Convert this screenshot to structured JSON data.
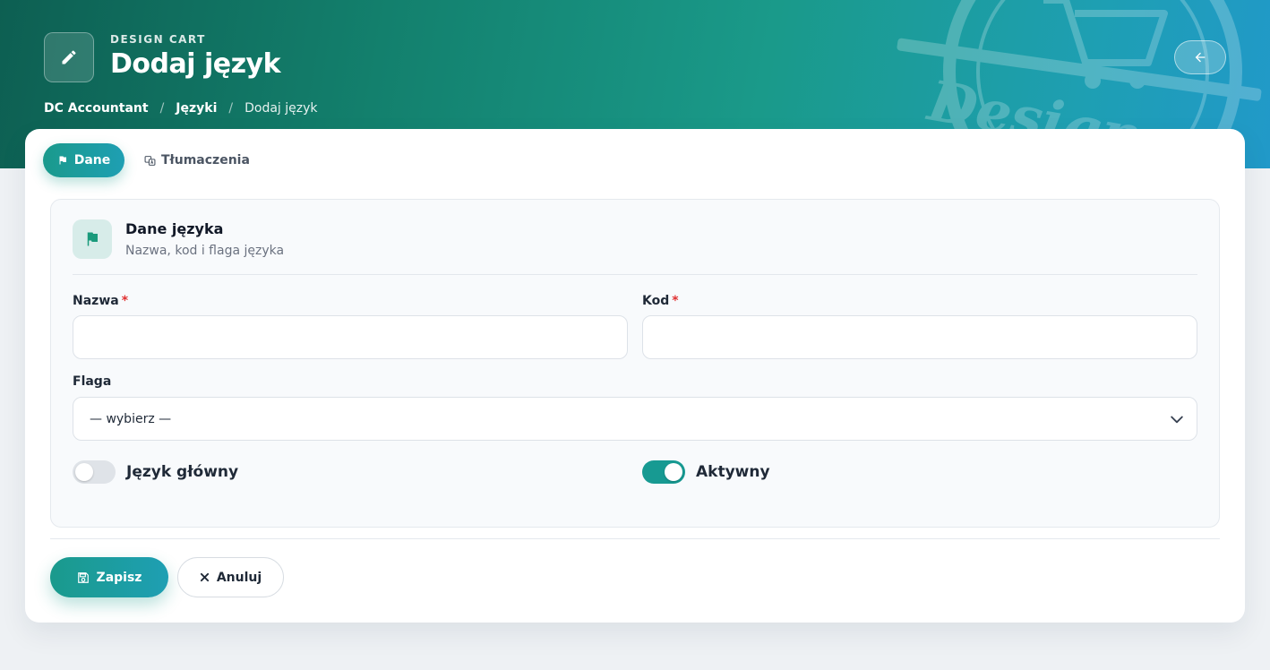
{
  "colors": {
    "accent": "#1a9a8c",
    "accent_alt": "#1e9fb3",
    "required": "#e03131",
    "hero_dark": "#0d5f52"
  },
  "header": {
    "icon": "pencil-icon",
    "kicker": "DESIGN CART",
    "title": "Dodaj język",
    "watermark_text": "Design",
    "back_icon": "arrow-left-icon"
  },
  "breadcrumb": {
    "items": [
      {
        "label": "DC Accountant"
      },
      {
        "label": "Języki"
      },
      {
        "label": "Dodaj język"
      }
    ],
    "separator": "/"
  },
  "tabs": [
    {
      "label": "Dane",
      "icon": "flag-icon",
      "active": true
    },
    {
      "label": "Tłumaczenia",
      "icon": "language-icon",
      "active": false
    }
  ],
  "panel": {
    "icon": "flag-icon",
    "title": "Dane języka",
    "subtitle": "Nazwa, kod i flaga języka"
  },
  "form": {
    "name": {
      "label": "Nazwa",
      "required_mark": "*",
      "value": "",
      "placeholder": ""
    },
    "code": {
      "label": "Kod",
      "required_mark": "*",
      "value": "",
      "placeholder": ""
    },
    "flag": {
      "label": "Flaga",
      "selected": "— wybierz —"
    },
    "main_language": {
      "label": "Język główny",
      "on": false
    },
    "active": {
      "label": "Aktywny",
      "on": true
    }
  },
  "actions": {
    "save_label": "Zapisz",
    "save_icon": "save-icon",
    "cancel_label": "Anuluj",
    "cancel_icon": "close-icon"
  }
}
